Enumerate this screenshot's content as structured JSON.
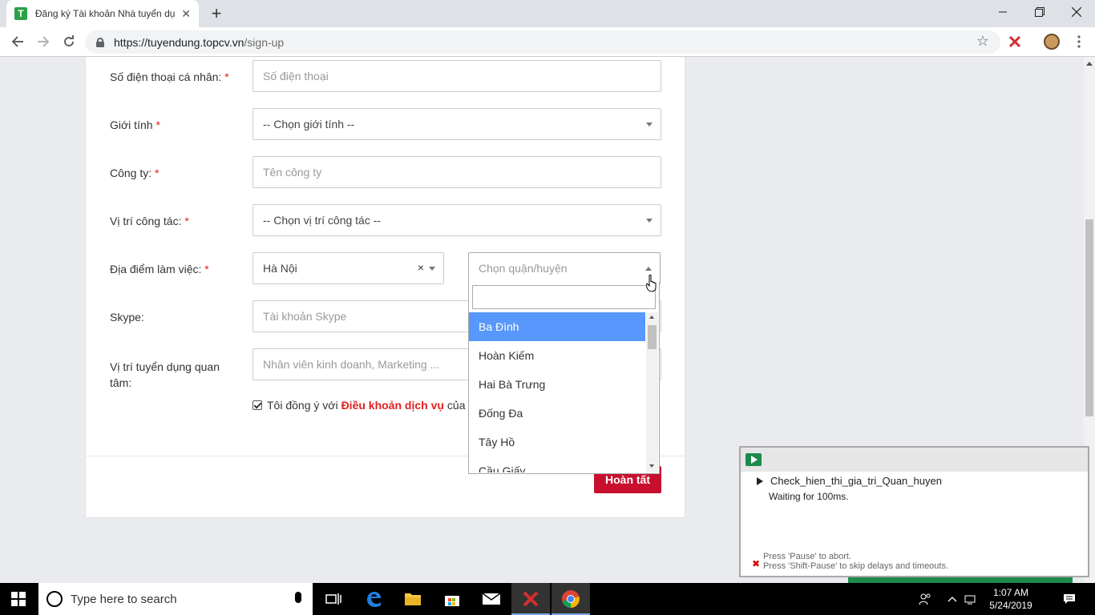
{
  "browser": {
    "tab_title": "Đăng ký Tài khoản Nhà tuyển dụ",
    "favicon_letter": "T",
    "url_host": "https://tuyendung.topcv.vn",
    "url_path": "/sign-up",
    "new_tab_label": "+",
    "close_tab_label": "✕"
  },
  "form": {
    "phone": {
      "label": "Số điện thoại cá nhân:",
      "required": "*",
      "placeholder": "Số điện thoại"
    },
    "gender": {
      "label": "Giới tính",
      "required": "*",
      "value": "-- Chọn giới tính --"
    },
    "company": {
      "label": "Công ty:",
      "required": "*",
      "placeholder": "Tên công ty"
    },
    "position": {
      "label": "Vị trí công tác:",
      "required": "*",
      "value": "-- Chọn vị trí công tác --"
    },
    "location": {
      "label": "Địa điểm làm việc:",
      "required": "*",
      "city": "Hà Nội",
      "clear": "×",
      "district_placeholder": "Chọn quận/huyện"
    },
    "skype": {
      "label": "Skype:",
      "placeholder": "Tài khoản Skype"
    },
    "interest": {
      "label_line1": "Vị trí tuyển dụng quan",
      "label_line2": "tâm:",
      "placeholder": "Nhân viên kinh doanh, Marketing ..."
    },
    "terms": {
      "prefix": "Tôi đồng ý với",
      "link": "Điều khoản dịch vụ",
      "suffix": "của To"
    },
    "submit_label": "Hoàn tất"
  },
  "dropdown": {
    "items": [
      "Ba Đình",
      "Hoàn Kiếm",
      "Hai Bà Trưng",
      "Đống Đa",
      "Tây Hồ",
      "Cầu Giấy"
    ],
    "highlighted_index": 0
  },
  "automation_panel": {
    "task_name": "Check_hien_thi_gia_tri_Quan_huyen",
    "status": "Waiting for 100ms.",
    "hint_line1": "Press 'Pause' to abort.",
    "hint_line2": "Press 'Shift-Pause' to skip delays and timeouts."
  },
  "taskbar": {
    "search_placeholder": "Type here to search",
    "time": "1:07 AM",
    "date": "5/24/2019"
  },
  "colors": {
    "accent_red": "#c8102e",
    "highlight_blue": "#5897fb",
    "topcv_green": "#2aa147"
  }
}
